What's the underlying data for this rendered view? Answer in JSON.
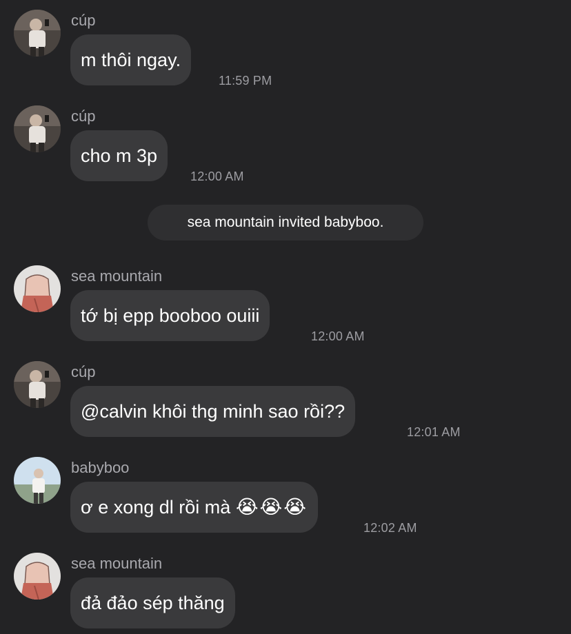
{
  "messages": [
    {
      "sender": "cúp",
      "text": "m thôi ngay.",
      "time": "11:59 PM",
      "avatar": "cup-avatar"
    },
    {
      "sender": "cúp",
      "text": "cho m 3p",
      "time": "12:00 AM",
      "avatar": "cup-avatar"
    },
    {
      "sender": "sea mountain",
      "text": "tớ bị epp booboo ouiii",
      "time": "12:00 AM",
      "avatar": "sea-mountain-avatar"
    },
    {
      "sender": "cúp",
      "text": "@calvin khôi thg minh sao rồi??",
      "time": "12:01 AM",
      "avatar": "cup-avatar"
    },
    {
      "sender": "babyboo",
      "text": "ơ e xong dl rồi mà",
      "emoji": "😭😭😭",
      "time": "12:02 AM",
      "avatar": "babyboo-avatar"
    },
    {
      "sender": "sea mountain",
      "text": "đả đảo sép thăng",
      "time": "",
      "avatar": "sea-mountain-avatar"
    }
  ],
  "system_notice": "sea mountain invited babyboo.",
  "colors": {
    "background": "#232325",
    "bubble": "#3a3a3c",
    "system_bubble": "#2f2f31",
    "sender_text": "#a9a9ae",
    "time_text": "#9d9da2",
    "message_text": "#ffffff"
  }
}
